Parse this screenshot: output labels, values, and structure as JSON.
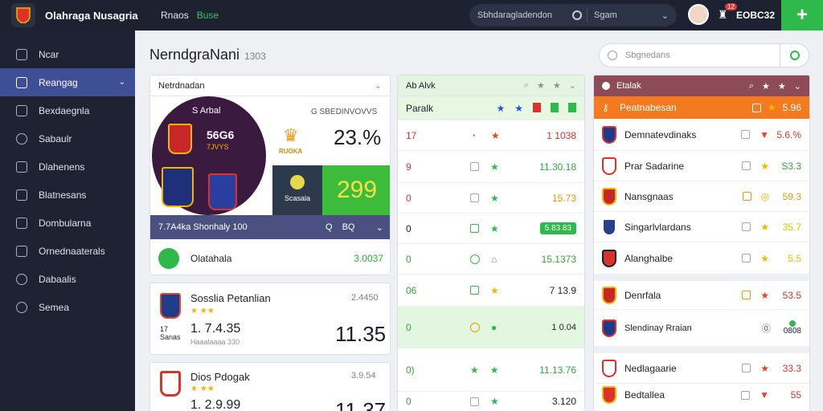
{
  "topbar": {
    "app_title": "Olahraga Nusagria",
    "links": [
      "Rnaos",
      "Buse"
    ],
    "search_text": "Sbhdaragladendon",
    "search_text2": "Sgam",
    "notif_count": "12",
    "user_name": "EOBC32",
    "add_label": "+"
  },
  "sidebar": {
    "items": [
      {
        "label": "Ncar"
      },
      {
        "label": "Reangag"
      },
      {
        "label": "Bexdaegnla"
      },
      {
        "label": "Sabaulr"
      },
      {
        "label": "Dlahenens"
      },
      {
        "label": "Blatnesans"
      },
      {
        "label": "Dombularna"
      },
      {
        "label": "Ornednaaterals"
      },
      {
        "label": "Dabaalis"
      },
      {
        "label": "Semea"
      }
    ]
  },
  "main": {
    "title": "NerndgraNani",
    "title_sub": "1303",
    "search_placeholder": "Sbgnedans"
  },
  "panel1": {
    "head": "Netrdnadan",
    "hero_label": "S Arbal",
    "hero_title": "G SBEDINVOVVS",
    "score1": "56G6",
    "score1_sub": "7JVYS",
    "brand_label": "RUOKA",
    "pct": "23.%",
    "brand2": "Scasala",
    "big_num": "299",
    "bar_text": "7.7A4ka Shonhaly 100",
    "bar_icons": [
      "Q",
      "BQ"
    ],
    "row_name": "Olatahala",
    "row_val": "3.0037"
  },
  "card_a": {
    "name": "Sosslia Petanlian",
    "odds": "2.4450",
    "value": "1. 7.4.35",
    "row_sub": "17 Sanas",
    "sub_text": "Haaalaaaa 330",
    "big": "11.35"
  },
  "card_b": {
    "name": "Dios Pdogak",
    "odds": "3.9.54",
    "value": "1. 2.9.99",
    "big": "11.37"
  },
  "panel2": {
    "head": "Ab Alvk",
    "sub": "Paralk",
    "rows": [
      {
        "a": "17",
        "b": "1 1038"
      },
      {
        "a": "9",
        "b": "11.30.18"
      },
      {
        "a": "0",
        "b": "15.73"
      },
      {
        "a": "0",
        "b": "5.83.83"
      },
      {
        "a": "0",
        "b": "15.1373"
      },
      {
        "a": "06",
        "b": "7 13.9"
      },
      {
        "a": "0",
        "b": "1 0.04"
      },
      {
        "a": "0)",
        "b": "11.13.76"
      },
      {
        "a": "0",
        "b": "3.120"
      }
    ]
  },
  "panel3": {
    "head": "Etalak",
    "orange": "Peatnabesan",
    "orange_val": "5.96",
    "rows": [
      {
        "name": "Demnatevdinaks",
        "val": "5.6.%"
      },
      {
        "name": "Prar Sadarine",
        "val": "S3.3"
      },
      {
        "name": "Nansgnaas",
        "val": "59.3"
      },
      {
        "name": "Singarlvlardans",
        "val": "35.7"
      },
      {
        "name": "Alanghalbe",
        "val": "5.5"
      },
      {
        "name": "Denrfala",
        "val": "53.5"
      },
      {
        "name": "Slendinay Rraian",
        "val": "0808"
      },
      {
        "name": "Nedlagaarie",
        "val": "33.3"
      },
      {
        "name": "Bedtallea",
        "val": "55"
      }
    ]
  }
}
